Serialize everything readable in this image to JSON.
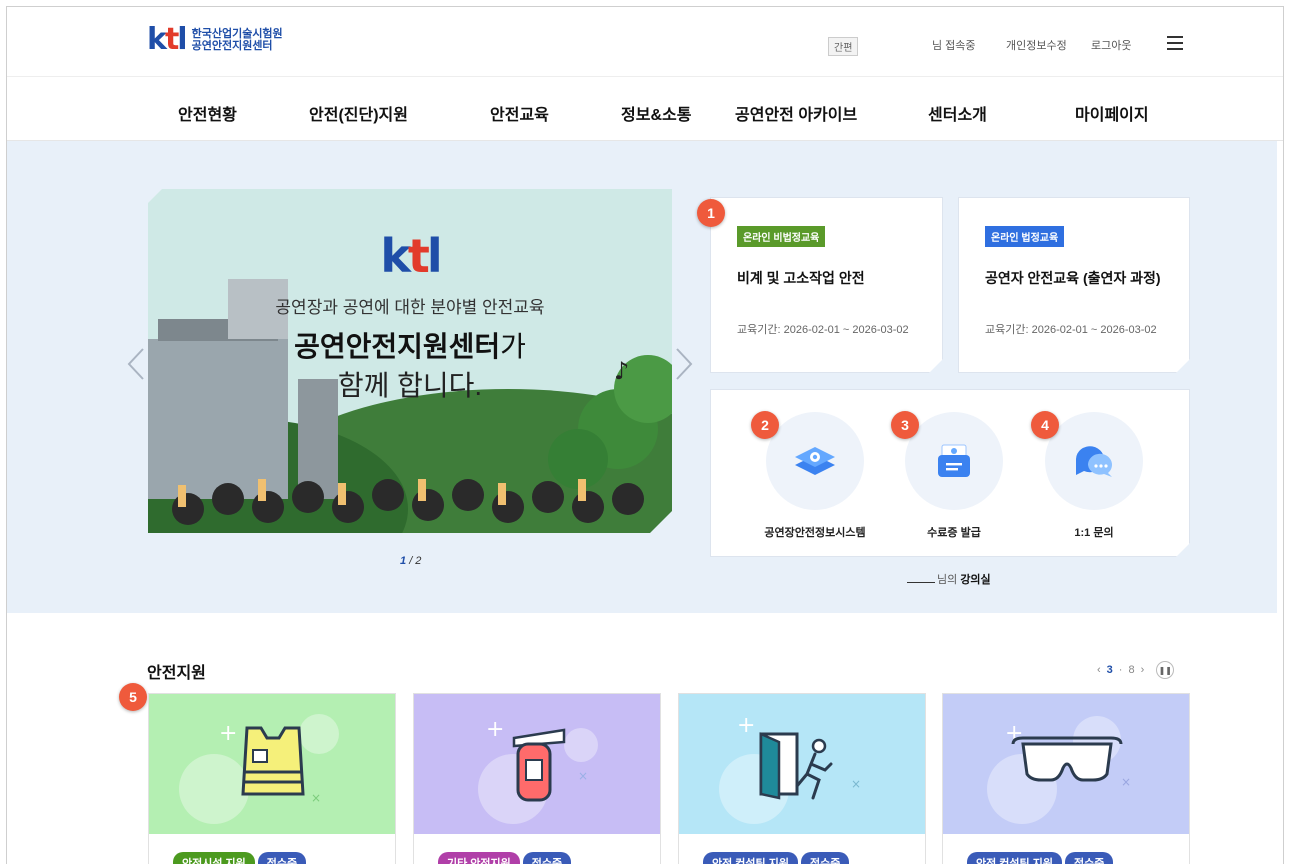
{
  "header": {
    "logo_mark": "ktl",
    "logo_line1": "한국산업기술시험원",
    "logo_line2": "공연안전지원센터",
    "simple_badge": "간편",
    "user_status": "님 접속중",
    "edit_profile": "개인정보수정",
    "logout": "로그아웃"
  },
  "gnb": [
    "안전현황",
    "안전(진단)지원",
    "안전교육",
    "정보&소통",
    "공연안전 아카이브",
    "센터소개",
    "마이페이지"
  ],
  "slider": {
    "logo": "ktl",
    "subtitle": "공연장과 공연에 대한 분야별 안전교육",
    "headline_bold": "공연안전지원센터",
    "headline_suffix": "가",
    "headline_line2": "함께 합니다.",
    "current_page": "1",
    "total_pages": "/ 2"
  },
  "courses": [
    {
      "tag": "온라인 비법정교육",
      "title": "비계 및 고소작업 안전",
      "period": "교육기간: 2026-02-01 ~ 2026-03-02",
      "tag_color": "#5a9a2a"
    },
    {
      "tag": "온라인 법정교육",
      "title": "공연자 안전교육 (출연자 과정)",
      "period": "교육기간: 2026-02-01 ~ 2026-03-02",
      "tag_color": "#2f6fe0"
    }
  ],
  "quick_links": [
    {
      "label": "공연장안전정보시스템",
      "icon": "settings-layer-icon"
    },
    {
      "label": "수료증 발급",
      "icon": "certificate-icon"
    },
    {
      "label": "1:1 문의",
      "icon": "chat-bubble-icon"
    }
  ],
  "lecture_room": {
    "suffix": "님의",
    "label": "강의실"
  },
  "markers": [
    "1",
    "2",
    "3",
    "4",
    "5"
  ],
  "support": {
    "title": "안전지원",
    "current": "3",
    "separator": "·",
    "total": "8",
    "cards": [
      {
        "category": "안전시설 지원",
        "status": "접수중",
        "icon": "safety-vest-icon",
        "bg": "#b4efb2",
        "cat_color": "#4c9a1f"
      },
      {
        "category": "기타 안전지원",
        "status": "접수중",
        "icon": "fire-extinguisher-icon",
        "bg": "#c7bdf5",
        "cat_color": "#b03fa8"
      },
      {
        "category": "안전 컨설팅 지원",
        "status": "접수중",
        "icon": "emergency-exit-icon",
        "bg": "#b5e6f7",
        "cat_color": "#3a5bb8"
      },
      {
        "category": "안전 컨설팅 지원",
        "status": "접수중",
        "icon": "safety-goggles-icon",
        "bg": "#c3ccf7",
        "cat_color": "#3a5bb8"
      }
    ]
  }
}
